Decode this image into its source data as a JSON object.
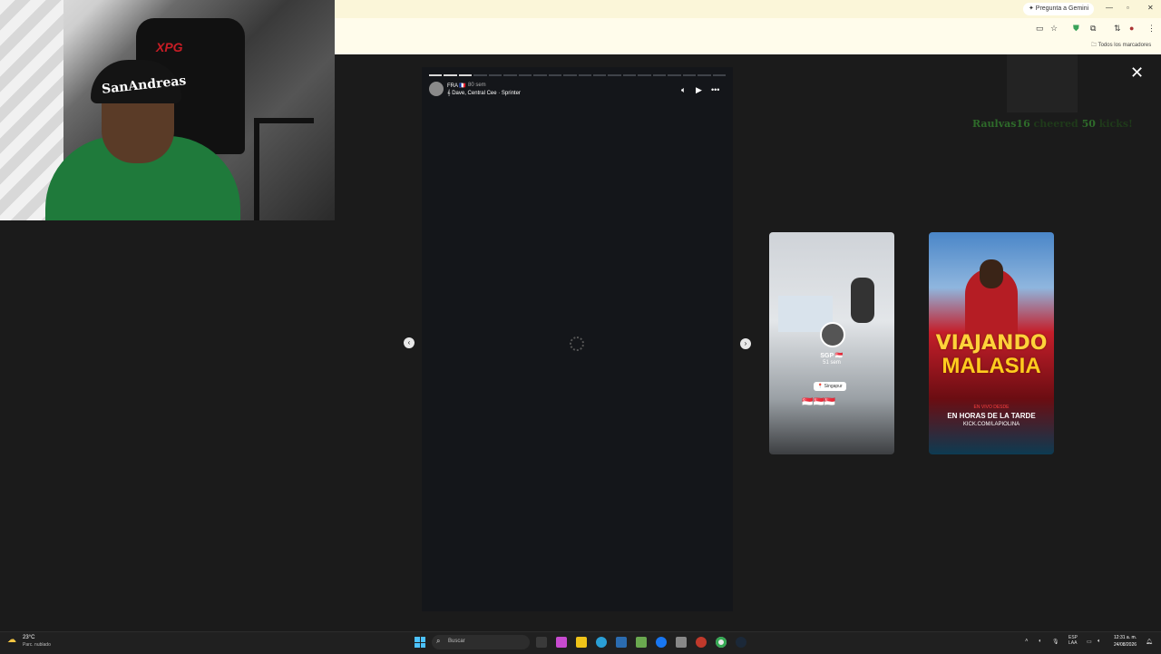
{
  "browser": {
    "gemini_label": "✦ Pregunta a Gemini",
    "bookmarks_label": "Todos los marcadores"
  },
  "webcam": {
    "cap_text": "SanAndreas",
    "chair_logo": "XPG"
  },
  "story": {
    "user": "FRA 🇫🇷",
    "time": "80 sem",
    "music": "Dave, Central Cee · Sprinter",
    "progress_total": 20,
    "progress_done": 3
  },
  "chat_overlay": {
    "user": "Raulvas16",
    "middle": " cheered ",
    "amount": "50",
    "suffix": " kicks!"
  },
  "previews": [
    {
      "user": "SGP 🇸🇬",
      "time": "51 sem",
      "location": "Singapur",
      "flags": "🇸🇬🇸🇬🇸🇬"
    },
    {
      "title_line1": "VIAJANDO",
      "title_line2": "MALASIA",
      "subtitle": "EN VIVO DESDE",
      "schedule": "EN HORAS DE LA TARDE",
      "url": "KICK.COM/LAPIOLINA"
    }
  ],
  "taskbar": {
    "weather_temp": "23°C",
    "weather_desc": "Parc. nublado",
    "search_placeholder": "Buscar",
    "lang_top": "ESP",
    "lang_bottom": "LAA",
    "time": "12:31 a. m.",
    "date": "24/08/2026"
  },
  "icons": {
    "close": "close-icon",
    "prev": "chevron-left-icon",
    "next": "chevron-right-icon"
  },
  "colors": {
    "browser_bar": "#fbf6d9",
    "viewer_bg": "#1b1b1b",
    "taskbar_bg": "#202020",
    "chat_user": "#2e6b2a"
  }
}
